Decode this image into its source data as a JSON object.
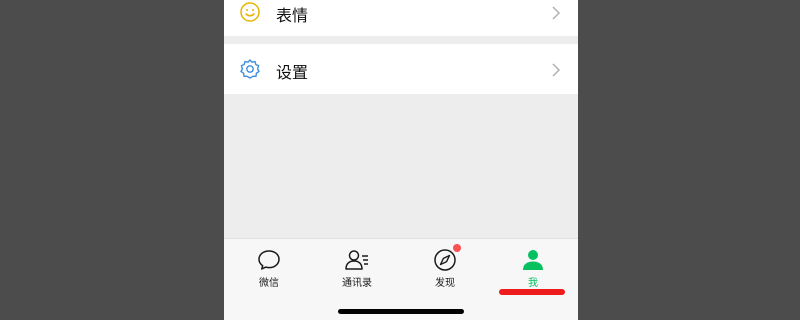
{
  "menu": {
    "items": [
      {
        "label": "表情",
        "icon": "smiley-icon"
      },
      {
        "label": "设置",
        "icon": "gear-icon"
      }
    ]
  },
  "tabbar": {
    "tabs": [
      {
        "label": "微信",
        "icon": "chat-bubble-icon",
        "active": false
      },
      {
        "label": "通讯录",
        "icon": "contacts-icon",
        "active": false
      },
      {
        "label": "发现",
        "icon": "compass-icon",
        "active": false,
        "badge": true
      },
      {
        "label": "我",
        "icon": "person-icon",
        "active": true
      }
    ]
  },
  "colors": {
    "accent": "#07c160",
    "badge": "#fa5151",
    "emoji_icon": "#e6b400",
    "settings_icon": "#3a8ee6",
    "annotation_underline": "#ee1c1c"
  }
}
